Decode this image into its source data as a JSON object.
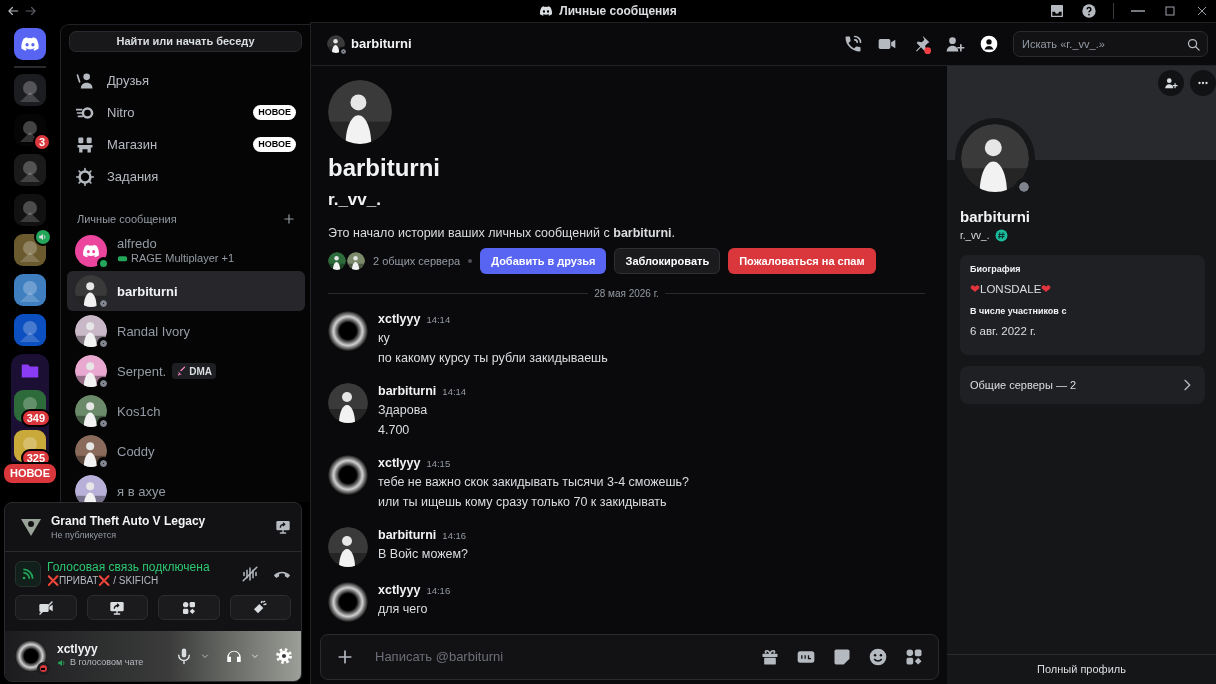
{
  "window": {
    "title": "Личные сообщения"
  },
  "servers": [
    {
      "kind": "home",
      "selected": true
    },
    {
      "kind": "server",
      "color": "#1c1d21",
      "selected": false
    },
    {
      "kind": "server",
      "color": "#050505",
      "badge": "3",
      "selected": false
    },
    {
      "kind": "server",
      "color": "#1a1a1a",
      "selected": false
    },
    {
      "kind": "server",
      "color": "#111111",
      "selected": false
    },
    {
      "kind": "server",
      "color": "#6b5a2e",
      "selected": false,
      "speaking": true
    },
    {
      "kind": "server",
      "color": "#3f7fc0",
      "selected": false
    },
    {
      "kind": "server",
      "color": "#0b4fc0",
      "selected": false
    },
    {
      "kind": "folder",
      "color": "#8a3cf5",
      "expanded": true,
      "children": [
        {
          "kind": "server",
          "color": "#2e6b3a",
          "badge": "349",
          "selected": false
        },
        {
          "kind": "server",
          "color": "#c9a93a",
          "badge": "325",
          "selected": false
        }
      ]
    }
  ],
  "servers_new_badge": "НОВОЕ",
  "search_button": "Найти или начать беседу",
  "dm_nav": [
    {
      "kind": "friends",
      "label": "Друзья",
      "selected": false
    },
    {
      "kind": "nitro",
      "label": "Nitro",
      "badge": "НОВОЕ",
      "selected": false
    },
    {
      "kind": "shop",
      "label": "Магазин",
      "badge": "НОВОЕ",
      "selected": false
    },
    {
      "kind": "quests",
      "label": "Задания",
      "selected": false
    }
  ],
  "dm_header": "Личные сообщения",
  "dms": [
    {
      "kind": "default",
      "name": "alfredo",
      "online": true,
      "activity": "RAGE Multiplayer +1",
      "color": "#eb459e",
      "selected": false
    },
    {
      "kind": "photo",
      "name": "barbiturni",
      "online": false,
      "color": "#3a3a3a",
      "selected": true
    },
    {
      "kind": "photo",
      "name": "Randal Ivory",
      "online": false,
      "color": "#c9b8c8",
      "selected": false
    },
    {
      "kind": "photo",
      "name": "Serpent.",
      "online": false,
      "tag": "DMA",
      "color": "#e8a8d0",
      "selected": false
    },
    {
      "kind": "photo",
      "name": "Kos1ch",
      "online": false,
      "color": "#6a8a6a",
      "selected": false
    },
    {
      "kind": "photo",
      "name": "Coddy",
      "online": false,
      "color": "#8a6a5a",
      "selected": false
    },
    {
      "kind": "photo",
      "name": "я в axye",
      "color": "#b8b0d8",
      "selected": false
    }
  ],
  "activity": {
    "game": "Grand Theft Auto V Legacy",
    "status": "Не публикуется"
  },
  "voice": {
    "status": "Голосовая связь подключена",
    "channel": "❌ПРИВАТ❌ / SKIFICH"
  },
  "user": {
    "name": "xctlyyy",
    "status_text": "В голосовом чате",
    "do_not_disturb": true
  },
  "chat_header": {
    "name": "barbiturni",
    "online": false,
    "pins_unread": true,
    "profile_open": true,
    "search_placeholder": "Искать «r._vv_.»"
  },
  "intro": {
    "name": "barbiturni",
    "username": "r._vv_.",
    "text": "Это начало истории ваших личных сообщений с **barbiturni**.",
    "mutual_servers": "2 общих сервера",
    "buttons": [
      {
        "kind": "primary",
        "label": "Добавить в друзья"
      },
      {
        "kind": "secondary",
        "label": "Заблокировать"
      },
      {
        "kind": "danger",
        "label": "Пожаловаться на спам"
      }
    ]
  },
  "date_divider": "28 мая 2026 г.",
  "messages": [
    {
      "kind": "smoke",
      "author": "xctlyyy",
      "time": "14:14",
      "lines": [
        "ку",
        "по какому курсу ты рубли закидываешь"
      ]
    },
    {
      "kind": "photo",
      "author": "barbiturni",
      "time": "14:14",
      "lines": [
        "Здарова",
        "4.700"
      ]
    },
    {
      "kind": "smoke",
      "author": "xctlyyy",
      "time": "14:15",
      "lines": [
        "тебе не важно скок закидывать тысячи 3-4 сможешь?",
        "или ты ищешь кому сразу только 70 к закидывать"
      ]
    },
    {
      "kind": "photo",
      "author": "barbiturni",
      "time": "14:16",
      "lines": [
        "В Войс можем?"
      ]
    },
    {
      "kind": "smoke",
      "author": "xctlyyy",
      "time": "14:16",
      "lines": [
        "для чего"
      ]
    }
  ],
  "composer": {
    "placeholder": "Написать @barbiturni"
  },
  "profile": {
    "name": "barbiturni",
    "username": "r._vv_.",
    "online": false,
    "sections": [
      {
        "label": "Биография",
        "value": "❤LONSDALE❤"
      },
      {
        "label": "В числе участников с",
        "value": "6 авг. 2022 г."
      }
    ],
    "mutual_servers": "Общие серверы — 2",
    "footer": "Полный профиль"
  }
}
